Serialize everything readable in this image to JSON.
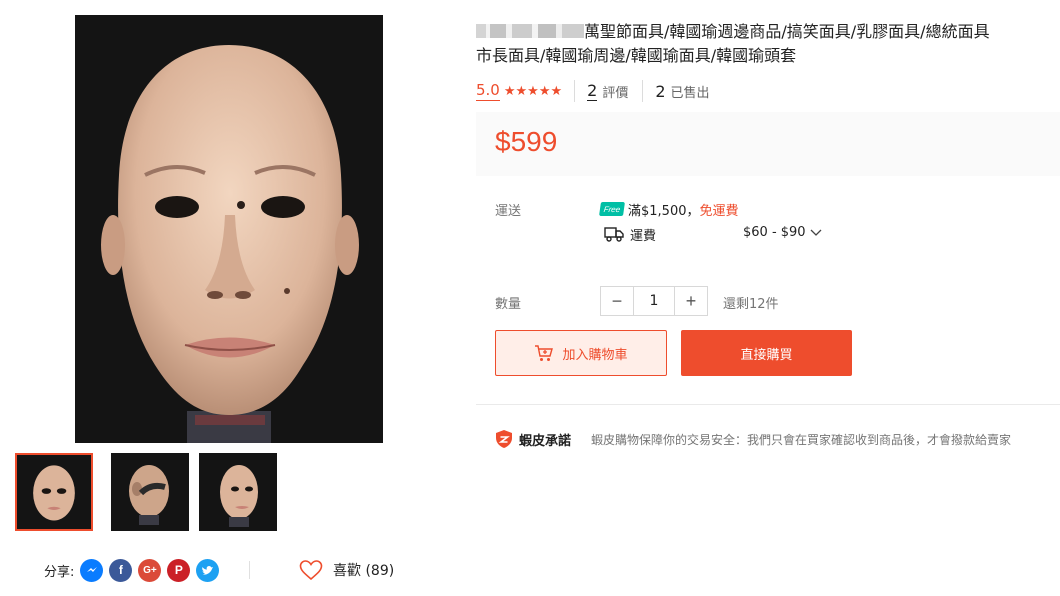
{
  "gallery": {
    "main_image_alt": "",
    "thumbnails": [
      "front",
      "side",
      "angle"
    ]
  },
  "share": {
    "label": "分享:",
    "icons": [
      "messenger-icon",
      "facebook-icon",
      "google-plus-icon",
      "pinterest-icon",
      "twitter-icon"
    ]
  },
  "like": {
    "label": "喜歡 (89)"
  },
  "product": {
    "title_line1": "萬聖節面具/韓國瑜週邊商品/搞笑面具/乳膠面具/總統面具",
    "title_line2": "市長面具/韓國瑜周邊/韓國瑜面具/韓國瑜頭套",
    "rating": "5.0",
    "stars": "★★★★★",
    "review_count": "2",
    "review_label": "評價",
    "sold_count": "2",
    "sold_label": "已售出",
    "price": "$599"
  },
  "shipping": {
    "label": "運送",
    "free_badge": "Free",
    "free_text": "滿$1,500，",
    "free_text_highlight": "免運費",
    "fee_label": "運費",
    "fee_range": "$60 - $90"
  },
  "quantity": {
    "label": "數量",
    "minus": "−",
    "value": "1",
    "plus": "+",
    "stock": "還剩12件"
  },
  "actions": {
    "add_to_cart": "加入購物車",
    "buy_now": "直接購買"
  },
  "guarantee": {
    "title": "蝦皮承諾",
    "text": "蝦皮購物保障你的交易安全：我們只會在買家確認收到商品後，才會撥款給賣家"
  },
  "colors": {
    "accent": "#ee4d2d",
    "free_badge": "#00bfa5"
  }
}
